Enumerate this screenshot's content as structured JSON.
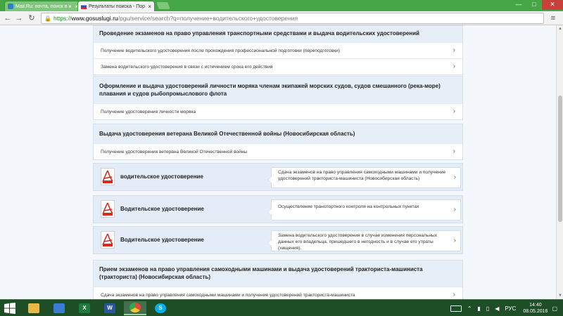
{
  "browser": {
    "tabs": [
      {
        "title": "Mail.Ru: почта, поиск в и",
        "favicon_color": "#2c82c9"
      },
      {
        "title": "Результаты поиска - Пор",
        "favicon_color": "#d52b1e"
      }
    ],
    "url_scheme": "https://",
    "url_host": "www.gosuslugi.ru",
    "url_path": "/pgu/service/search?q=получение+водительского+удостоверения"
  },
  "groups": [
    {
      "title": "Проведение экзаменов на право управления транспортными средствами и выдача водительских удостоверений",
      "items": [
        "Получение водительского удостоверения после прохождения профессиональной подготовки (переподготовки)",
        "Замена водительского удостоверения в связи с истечением срока его действия"
      ]
    },
    {
      "title": "Оформление и выдача удостоверений личности моряка членам экипажей морских судов, судов смешанного (река-море) плавания и судов рыбопромыслового флота",
      "items": [
        "Получение удостоверения личности моряка"
      ]
    },
    {
      "title": "Выдача удостоверения ветерана Великой Отечественной войны (Новосибирская область)",
      "items": [
        "Получение удостоверения ветерана Великой Отечественной войны"
      ]
    },
    {
      "title": "Прием экзаменов на право управления самоходными машинами и выдача удостоверений тракториста-машиниста (тракториста) (Новосибирская область)",
      "items": [
        "Сдача экзаменов на право управления самоходными машинами и получение удостоверений тракториста-машиниста"
      ]
    }
  ],
  "documents": [
    {
      "title": "водительское удостоверение",
      "description": "Сдача экзаменов на право управления самоходными машинами и получение удостоверений тракториста-машиниста (Новосибирская область)"
    },
    {
      "title": "Водительское удостоверение",
      "description": "Осуществление транспортного контроля на контрольных пунктах"
    },
    {
      "title": "Водительское удостоверение",
      "description": "Замена водительского удостоверения в случае изменения персональных данных его владельца, пришедшего в негодность и в случае его утраты (хищения)."
    }
  ],
  "taskbar": {
    "apps": [
      {
        "name": "file-explorer",
        "label": "",
        "color": "#e8b84a"
      },
      {
        "name": "computer",
        "label": "",
        "color": "#3a7bd5"
      },
      {
        "name": "excel",
        "label": "X",
        "color": "#1f7a3f"
      },
      {
        "name": "word",
        "label": "W",
        "color": "#2b579a"
      },
      {
        "name": "chrome",
        "label": "",
        "color": "#e04a3a"
      },
      {
        "name": "skype",
        "label": "S",
        "color": "#00aff0"
      }
    ],
    "language": "РУС",
    "time": "14:40",
    "date": "08.05.2016"
  }
}
